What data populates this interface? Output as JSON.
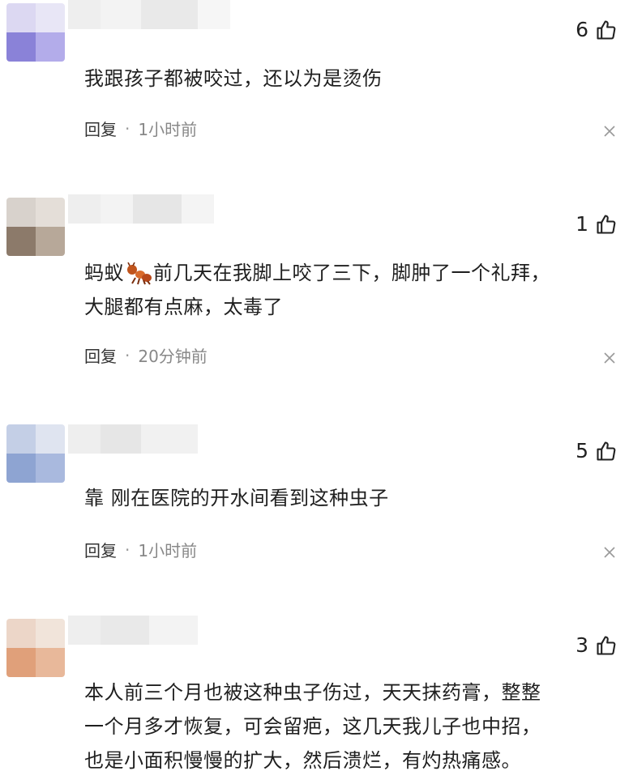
{
  "comments": [
    {
      "likes": "6",
      "text": "我跟孩子都被咬过，还以为是烫伤",
      "reply_label": "回复",
      "separator": "·",
      "time": "1小时前",
      "avatar_colors": [
        "#dcd8f2",
        "#e8e6f6",
        "#8a82d8",
        "#b3acea"
      ]
    },
    {
      "likes": "1",
      "text_before_emoji": "蚂蚁",
      "emoji": "ant-emoji",
      "text_line1_rest": "前几天在我脚上咬了三下，脚肿了一个礼拜，",
      "text_line2": "大腿都有点麻，太毒了",
      "reply_label": "回复",
      "separator": "·",
      "time": "20分钟前",
      "avatar_colors": [
        "#d8d2cc",
        "#e4ded8",
        "#8c7a6a",
        "#b7a899"
      ]
    },
    {
      "likes": "5",
      "text": "靠 刚在医院的开水间看到这种虫子",
      "reply_label": "回复",
      "separator": "·",
      "time": "1小时前",
      "avatar_colors": [
        "#c4cfe6",
        "#dfe4f0",
        "#8ea4d2",
        "#a9b9de"
      ]
    },
    {
      "likes": "3",
      "text_line1": "本人前三个月也被这种虫子伤过，天天抹药膏，整整",
      "text_line2": "一个月多才恢复，可会留疤，这几天我儿子也中招，",
      "text_line3": "也是小面积慢慢的扩大，然后溃烂，有灼热痛感。",
      "avatar_colors": [
        "#ecd6c8",
        "#f1e4da",
        "#e0a07a",
        "#e8b89a"
      ]
    }
  ]
}
